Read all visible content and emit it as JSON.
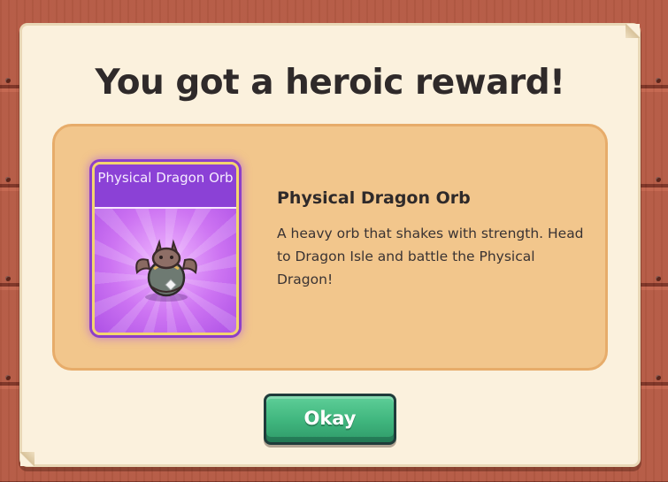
{
  "dialog": {
    "title": "You got a heroic reward!",
    "ok_label": "Okay"
  },
  "reward": {
    "card_name": "Physical Dragon Orb",
    "item_name": "Physical Dragon Orb",
    "description": "A heavy orb that shakes with strength. Head to Dragon Isle and battle the Physical Dragon!",
    "rarity_color": "#8b41d6",
    "icon": "dragon-orb-icon"
  },
  "colors": {
    "panel": "#fbf1dd",
    "reward_box": "#f2c68c",
    "button": "#3fb57d",
    "wood": "#b65b45"
  }
}
